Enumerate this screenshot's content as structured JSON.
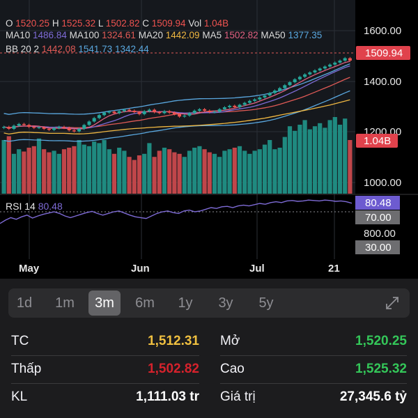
{
  "header": {
    "ohlc": [
      {
        "k": "O",
        "v": "1520.25"
      },
      {
        "k": "H",
        "v": "1525.32"
      },
      {
        "k": "L",
        "v": "1502.82"
      },
      {
        "k": "C",
        "v": "1509.94"
      },
      {
        "k": "Vol",
        "v": "1.04B"
      }
    ],
    "ma": [
      {
        "k": "MA10",
        "v": "1486.84",
        "color": "#7e6bd6"
      },
      {
        "k": "MA100",
        "v": "1324.61",
        "color": "#e05a56"
      },
      {
        "k": "MA20",
        "v": "1442.09",
        "color": "#f0b842"
      },
      {
        "k": "MA5",
        "v": "1502.82",
        "color": "#e06080"
      },
      {
        "k": "MA50",
        "v": "1377.35",
        "color": "#5aa8e0"
      }
    ],
    "bb": {
      "label": "BB 20 2",
      "values": [
        "1442.08",
        "1541.73",
        "1342.44"
      ],
      "colors": [
        "#e05a56",
        "#5aa8e0",
        "#5aa8e0"
      ]
    }
  },
  "price_axis": [
    "1600.00",
    "1400.00",
    "1200.00",
    "1000.00",
    "800.00"
  ],
  "price_badge": "1509.94",
  "volume_badge": "1.04B",
  "rsi": {
    "label": "RSI 14",
    "value": "80.48",
    "upper": "70.00",
    "lower": "30.00"
  },
  "x_labels": [
    "May",
    "Jun",
    "Jul",
    "21"
  ],
  "tabs": [
    "1d",
    "1m",
    "3m",
    "6m",
    "1y",
    "3y",
    "5y"
  ],
  "active_tab": "3m",
  "stats": {
    "tc_label": "TC",
    "tc_value": "1,512.31",
    "mo_label": "Mở",
    "mo_value": "1,520.25",
    "thap_label": "Thấp",
    "thap_value": "1,502.82",
    "cao_label": "Cao",
    "cao_value": "1,525.32",
    "kl_label": "KL",
    "kl_value": "1,111.03 tr",
    "gt_label": "Giá trị",
    "gt_value": "27,345.6 tỷ"
  },
  "colors": {
    "up": "#26a69a",
    "down": "#ef5350",
    "ref": "#f0c040",
    "rsi": "#7e6bd6",
    "badge_red": "#e0424c"
  },
  "chart_data": {
    "type": "candlestick",
    "price_ylim": [
      1000,
      1620
    ],
    "closes": [
      1240,
      1232,
      1245,
      1252,
      1248,
      1240,
      1236,
      1238,
      1232,
      1228,
      1235,
      1240,
      1236,
      1226,
      1222,
      1232,
      1248,
      1262,
      1276,
      1288,
      1298,
      1302,
      1296,
      1304,
      1310,
      1306,
      1300,
      1292,
      1304,
      1310,
      1300,
      1296,
      1304,
      1298,
      1292,
      1282,
      1286,
      1296,
      1306,
      1312,
      1306,
      1300,
      1302,
      1312,
      1320,
      1326,
      1320,
      1330,
      1338,
      1346,
      1352,
      1360,
      1368,
      1378,
      1388,
      1398,
      1410,
      1422,
      1434,
      1444,
      1454,
      1462,
      1470,
      1478,
      1486,
      1494,
      1502,
      1510,
      1520,
      1509.94
    ],
    "volumes": [
      70,
      75,
      52,
      58,
      55,
      60,
      62,
      72,
      58,
      54,
      56,
      52,
      58,
      60,
      62,
      70,
      64,
      62,
      68,
      66,
      70,
      58,
      52,
      60,
      56,
      48,
      44,
      50,
      52,
      66,
      48,
      56,
      60,
      58,
      54,
      52,
      48,
      56,
      60,
      62,
      58,
      54,
      52,
      48,
      56,
      58,
      60,
      62,
      56,
      52,
      56,
      58,
      64,
      70,
      58,
      60,
      74,
      88,
      82,
      90,
      96,
      84,
      88,
      92,
      86,
      96,
      100,
      90,
      98,
      70
    ],
    "rsi_values": [
      32,
      40,
      46,
      42,
      48,
      52,
      45,
      50,
      54,
      57,
      60,
      56,
      50,
      46,
      50,
      54,
      58,
      61,
      56,
      52,
      56,
      60,
      62,
      57,
      52,
      48,
      46,
      44,
      50,
      56,
      60,
      62,
      58,
      56,
      62,
      64,
      60,
      62,
      66,
      70,
      68,
      72,
      73,
      70,
      74,
      76,
      74,
      77,
      80,
      78,
      82,
      84,
      82,
      86,
      87,
      85,
      86,
      88,
      87,
      86,
      88,
      87,
      85,
      86,
      84,
      80.48
    ],
    "rsi_ylim": [
      0,
      100
    ]
  }
}
